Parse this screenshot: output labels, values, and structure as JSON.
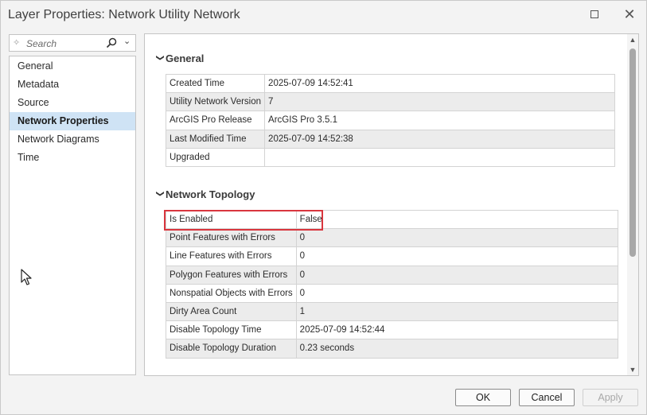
{
  "window": {
    "title": "Layer Properties: Network Utility Network"
  },
  "search": {
    "placeholder": "Search"
  },
  "sidebar": {
    "items": [
      {
        "label": "General",
        "selected": false
      },
      {
        "label": "Metadata",
        "selected": false
      },
      {
        "label": "Source",
        "selected": false
      },
      {
        "label": "Network Properties",
        "selected": true
      },
      {
        "label": "Network Diagrams",
        "selected": false
      },
      {
        "label": "Time",
        "selected": false
      }
    ]
  },
  "general": {
    "heading": "General",
    "rows": [
      {
        "name": "Created Time",
        "value": "2025-07-09 14:52:41"
      },
      {
        "name": "Utility Network Version",
        "value": "7"
      },
      {
        "name": "ArcGIS Pro Release",
        "value": "ArcGIS Pro 3.5.1"
      },
      {
        "name": "Last Modified Time",
        "value": "2025-07-09 14:52:38"
      },
      {
        "name": "Upgraded",
        "value": ""
      }
    ]
  },
  "topology": {
    "heading": "Network Topology",
    "rows": [
      {
        "name": "Is Enabled",
        "value": "False"
      },
      {
        "name": "Point Features with Errors",
        "value": "0"
      },
      {
        "name": "Line Features with Errors",
        "value": "0"
      },
      {
        "name": "Polygon Features with Errors",
        "value": "0"
      },
      {
        "name": "Nonspatial Objects with Errors",
        "value": "0"
      },
      {
        "name": "Dirty Area Count",
        "value": "1"
      },
      {
        "name": "Disable Topology Time",
        "value": "2025-07-09 14:52:44"
      },
      {
        "name": "Disable Topology Duration",
        "value": "0.23 seconds"
      }
    ]
  },
  "buttons": {
    "ok": "OK",
    "cancel": "Cancel",
    "apply": "Apply"
  },
  "colors": {
    "selected_nav": "#cfe3f5",
    "highlight_border": "#d9363e"
  }
}
